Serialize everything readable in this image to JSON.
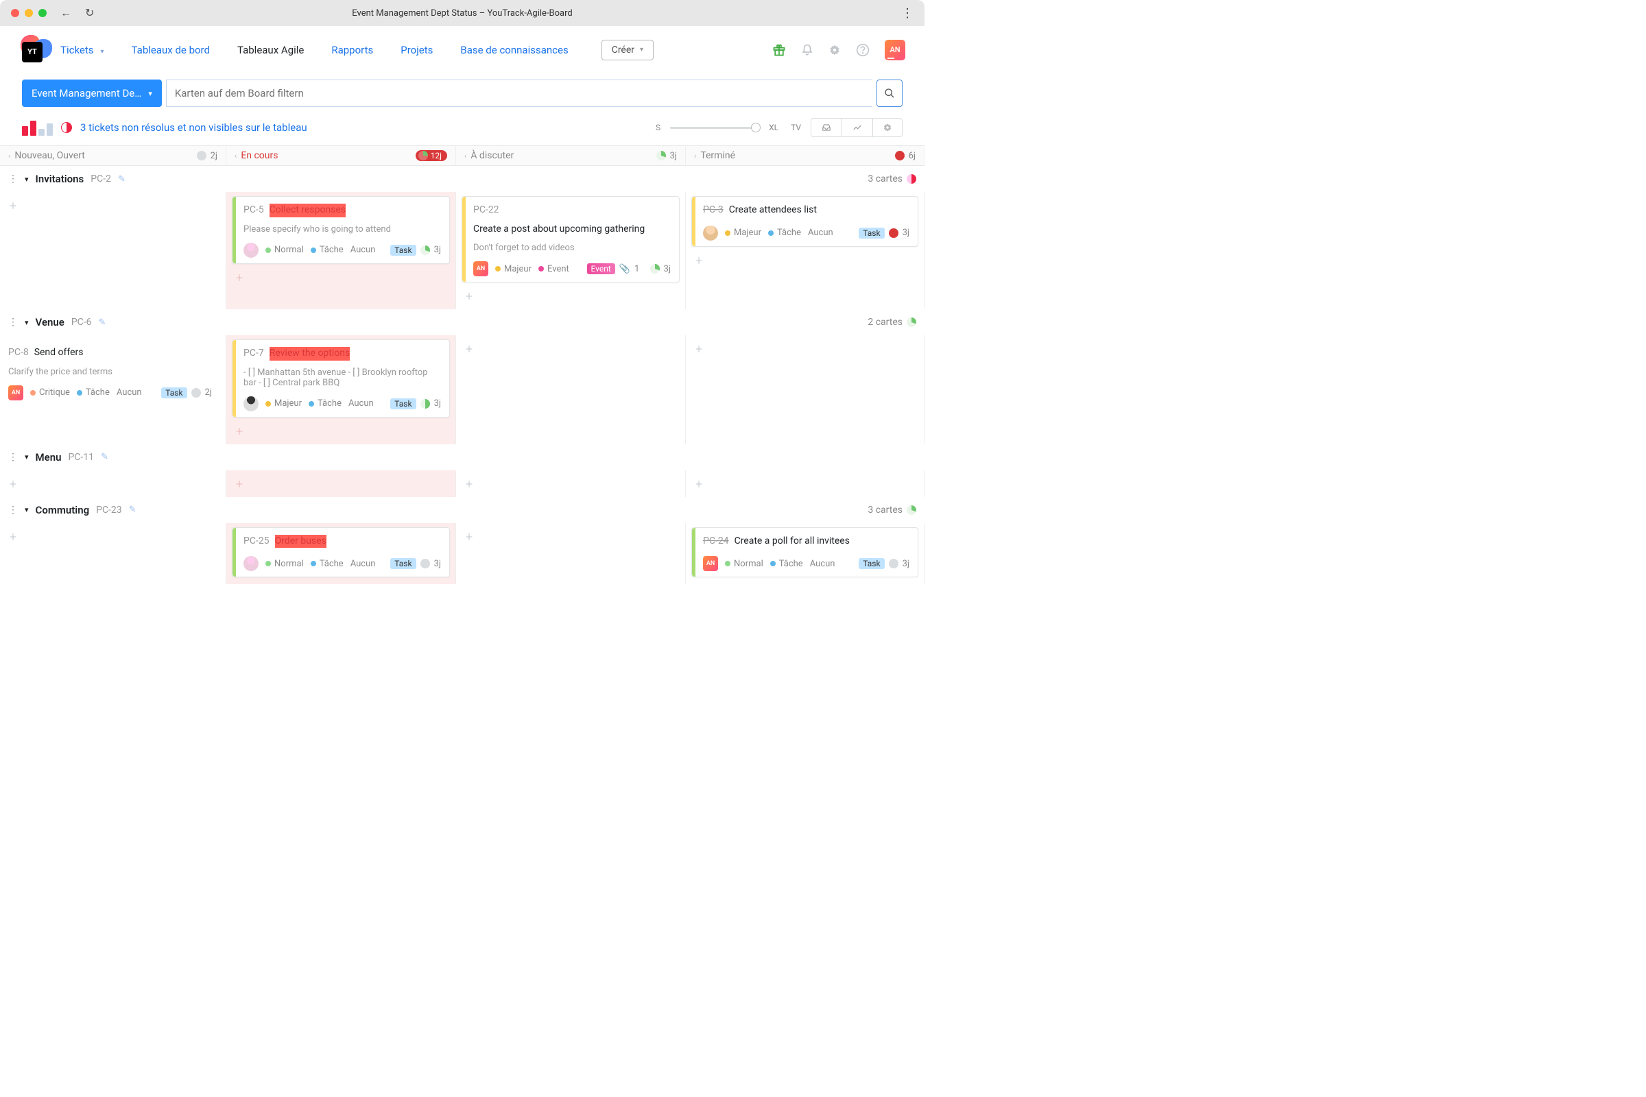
{
  "window": {
    "title": "Event Management Dept Status – YouTrack-Agile-Board"
  },
  "nav": {
    "tickets": "Tickets",
    "dashboards": "Tableaux de bord",
    "agile": "Tableaux Agile",
    "reports": "Rapports",
    "projects": "Projets",
    "kb": "Base de connaissances",
    "create": "Créer",
    "avatar": "AN"
  },
  "filter": {
    "board": "Event Management De…",
    "placeholder": "Karten auf dem Board filtern"
  },
  "toolbar": {
    "warning": "3 tickets non résolus et non visibles sur le tableau",
    "sizeS": "S",
    "sizeXL": "XL",
    "tv": "TV"
  },
  "columns": [
    {
      "name": "Nouveau, Ouvert",
      "est": "2j",
      "pie": "grey"
    },
    {
      "name": "En cours",
      "est": "12j",
      "pie": "redpill",
      "red": true
    },
    {
      "name": "À discuter",
      "est": "3j",
      "pie": "green"
    },
    {
      "name": "Terminé",
      "est": "6j",
      "pie": "red"
    }
  ],
  "lanes": {
    "invitations": {
      "title": "Invitations",
      "id": "PC-2",
      "meta": "3 cartes",
      "cards": {
        "pc5": {
          "id": "PC-5",
          "title": "Collect responses",
          "desc": "Please specify who is going to attend",
          "prio": "Normal",
          "type": "Tâche",
          "extra": "Aucun",
          "tag": "Task",
          "est": "3j"
        },
        "pc22": {
          "id": "PC-22",
          "title": "Create a post about upcoming gathering",
          "desc": "Don't forget to add videos",
          "prio": "Majeur",
          "type": "Event",
          "tag": "Event",
          "att": "1",
          "est": "3j"
        },
        "pc3": {
          "id": "PC-3",
          "title": "Create attendees list",
          "prio": "Majeur",
          "type": "Tâche",
          "extra": "Aucun",
          "tag": "Task",
          "est": "3j"
        }
      }
    },
    "venue": {
      "title": "Venue",
      "id": "PC-6",
      "meta": "2 cartes",
      "cards": {
        "pc8": {
          "id": "PC-8",
          "title": "Send offers",
          "desc": "Clarify the price and terms",
          "prio": "Critique",
          "type": "Tâche",
          "extra": "Aucun",
          "tag": "Task",
          "est": "2j"
        },
        "pc7": {
          "id": "PC-7",
          "title": "Review the options",
          "desc": "- [ ] Manhattan 5th avenue - [ ] Brooklyn rooftop bar - [ ] Central park BBQ",
          "prio": "Majeur",
          "type": "Tâche",
          "extra": "Aucun",
          "tag": "Task",
          "est": "3j"
        }
      }
    },
    "menu": {
      "title": "Menu",
      "id": "PC-11"
    },
    "commuting": {
      "title": "Commuting",
      "id": "PC-23",
      "meta": "3 cartes",
      "cards": {
        "pc25": {
          "id": "PC-25",
          "title": "Order buses",
          "prio": "Normal",
          "type": "Tâche",
          "extra": "Aucun",
          "tag": "Task",
          "est": "3j"
        },
        "pc24": {
          "id": "PC-24",
          "title": "Create a poll for all invitees",
          "prio": "Normal",
          "type": "Tâche",
          "extra": "Aucun",
          "tag": "Task",
          "est": "3j"
        }
      }
    }
  }
}
